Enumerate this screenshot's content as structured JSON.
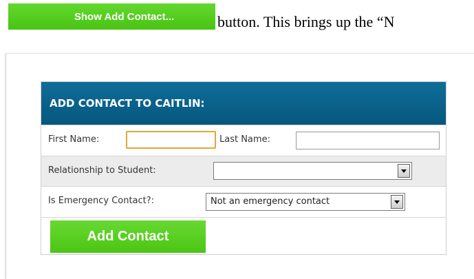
{
  "top": {
    "show_button_label": "Show Add Contact...",
    "text_line": "button.  This brings up the “N"
  },
  "form": {
    "header": "ADD CONTACT TO CAITLIN:",
    "first_name_label": "First Name:",
    "first_name_value": "",
    "last_name_label": "Last Name:",
    "last_name_value": "",
    "relationship_label": "Relationship to Student:",
    "relationship_value": "",
    "emergency_label": "Is Emergency Contact?:",
    "emergency_value": "Not an emergency contact",
    "add_button_label": "Add Contact"
  },
  "colors": {
    "header_blue": "#0a6590",
    "button_green": "#56cc1f",
    "focus_orange": "#e3a63a"
  },
  "icons": {
    "dropdown": "chevron-down-icon"
  }
}
